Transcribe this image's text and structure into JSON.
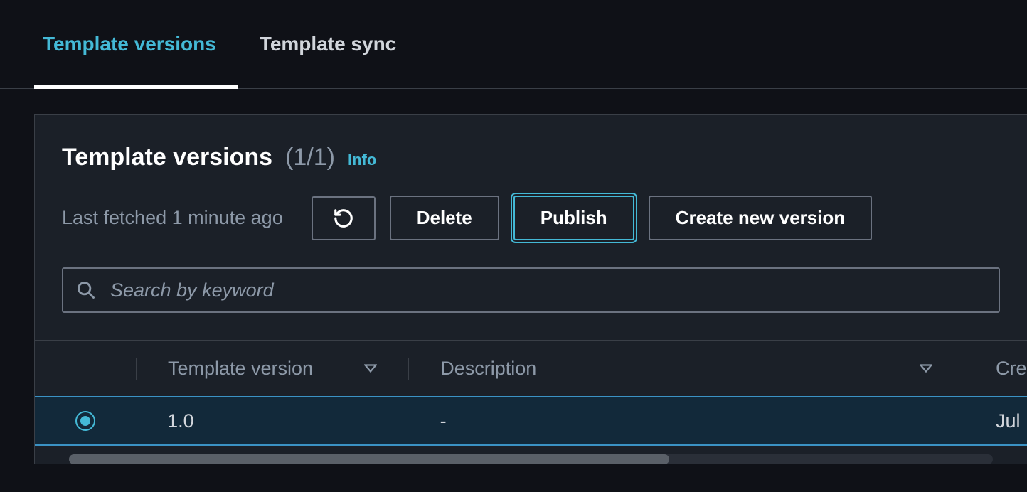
{
  "tabs": [
    {
      "label": "Template versions",
      "active": true
    },
    {
      "label": "Template sync",
      "active": false
    }
  ],
  "panel": {
    "title": "Template versions",
    "count": "(1/1)",
    "info_label": "Info",
    "last_fetched": "Last fetched 1 minute ago",
    "buttons": {
      "delete": "Delete",
      "publish": "Publish",
      "create": "Create new version"
    },
    "search": {
      "placeholder": "Search by keyword",
      "value": ""
    }
  },
  "table": {
    "columns": {
      "version": "Template version",
      "description": "Description",
      "created": "Cre"
    },
    "rows": [
      {
        "selected": true,
        "version": "1.0",
        "description": "-",
        "created": "Jul"
      }
    ]
  }
}
